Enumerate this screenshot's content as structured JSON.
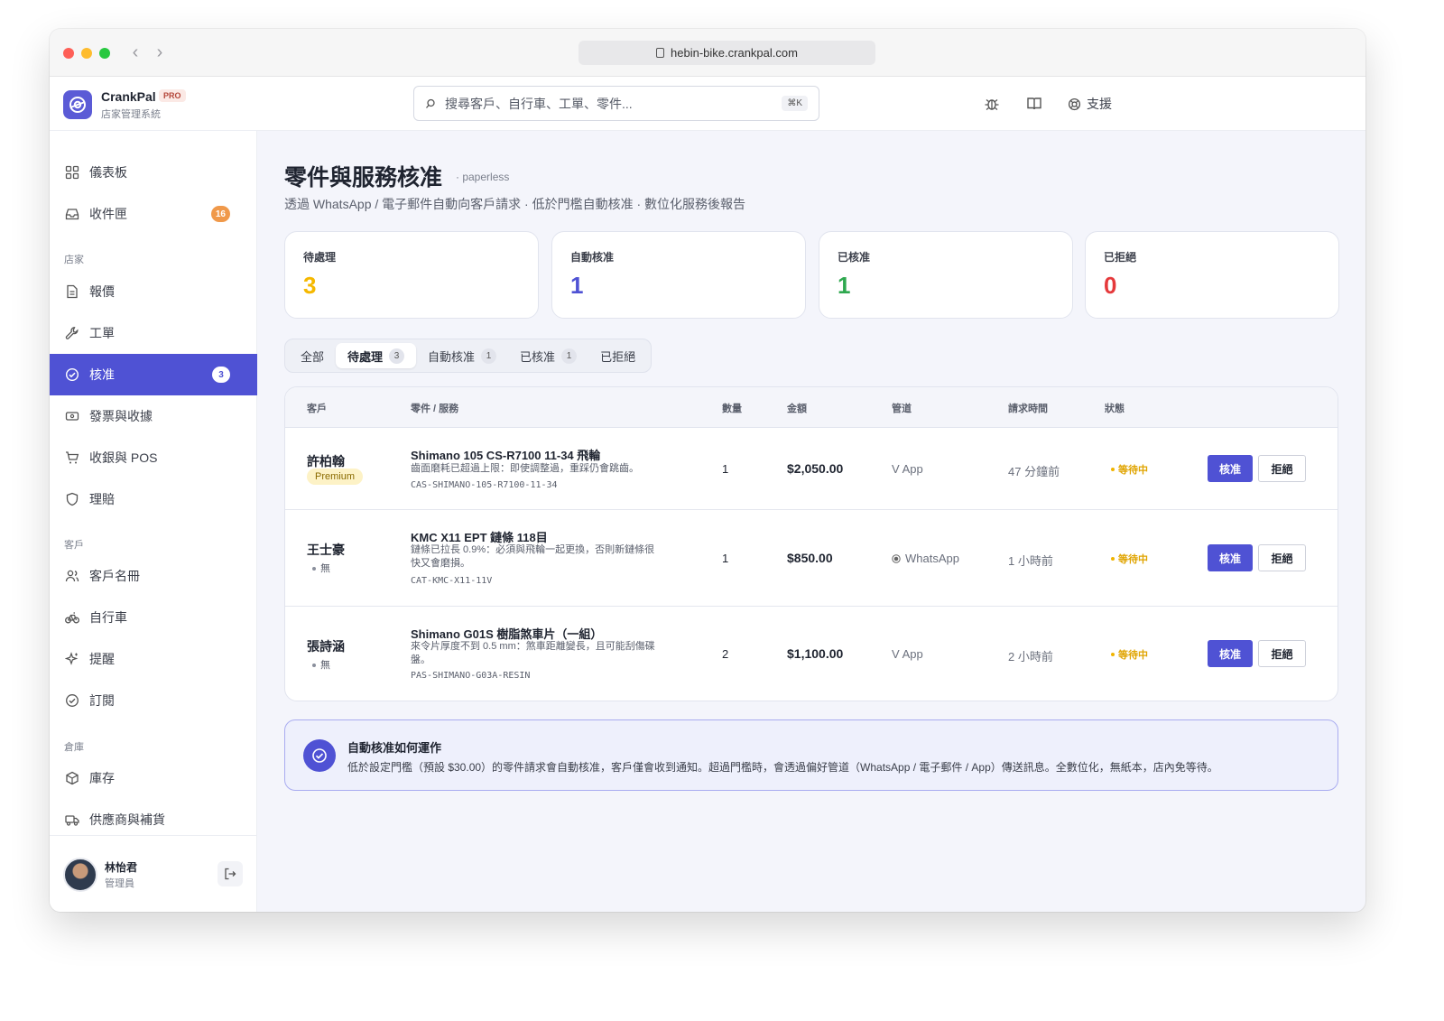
{
  "browser": {
    "url": "hebin-bike.crankpal.com"
  },
  "brand": {
    "name": "CrankPal",
    "badge": "PRO",
    "subtitle": "店家管理系統"
  },
  "search": {
    "placeholder": "搜尋客戶、自行車、工單、零件...",
    "shortcut": "⌘K"
  },
  "topbar": {
    "support_label": "支援"
  },
  "sidebar": {
    "items": [
      {
        "label": "儀表板"
      },
      {
        "label": "收件匣",
        "badge": "16"
      },
      {
        "label": "報價"
      },
      {
        "label": "工單"
      },
      {
        "label": "核准",
        "badge": "3"
      },
      {
        "label": "發票與收據"
      },
      {
        "label": "收銀與 POS"
      },
      {
        "label": "理賠"
      },
      {
        "label": "客戶名冊"
      },
      {
        "label": "自行車"
      },
      {
        "label": "提醒"
      },
      {
        "label": "訂閱"
      },
      {
        "label": "庫存"
      },
      {
        "label": "供應商與補貨"
      }
    ],
    "sections": [
      "店家",
      "客戶",
      "倉庫"
    ],
    "user": {
      "name": "林怡君",
      "role": "管理員"
    }
  },
  "page": {
    "title": "零件與服務核准",
    "tag": "· paperless",
    "subtitle": "透過 WhatsApp / 電子郵件自動向客戶請求 · 低於門檻自動核准 · 數位化服務後報告"
  },
  "stats": [
    {
      "label": "待處理",
      "value": "3",
      "color": "#f5b800"
    },
    {
      "label": "自動核准",
      "value": "1",
      "color": "#4f52d4"
    },
    {
      "label": "已核准",
      "value": "1",
      "color": "#2fa84f"
    },
    {
      "label": "已拒絕",
      "value": "0",
      "color": "#e5393b"
    }
  ],
  "filters": [
    {
      "label": "全部"
    },
    {
      "label": "待處理",
      "count": "3"
    },
    {
      "label": "自動核准",
      "count": "1"
    },
    {
      "label": "已核准",
      "count": "1"
    },
    {
      "label": "已拒絕"
    }
  ],
  "table": {
    "headers": [
      "客戶",
      "零件 / 服務",
      "數量",
      "金額",
      "管道",
      "請求時間",
      "狀態"
    ],
    "approve_label": "核准",
    "reject_label": "拒絕",
    "rows": [
      {
        "customer": "許柏翰",
        "tier": "Premium",
        "part": "Shimano 105 CS-R7100 11-34 飛輪",
        "note": "齒面磨耗已超過上限：即使調整過，重踩仍會跳齒。",
        "sku": "CAS-SHIMANO-105-R7100-11-34",
        "qty": "1",
        "amount": "$2,050.00",
        "channel": "V App",
        "time": "47 分鐘前",
        "status": "等待中"
      },
      {
        "customer": "王士豪",
        "tier": "無",
        "part": "KMC X11 EPT 鏈條 118目",
        "note": "鏈條已拉長 0.9%：必須與飛輪一起更換，否則新鏈條很快又會磨損。",
        "sku": "CAT-KMC-X11-11V",
        "qty": "1",
        "amount": "$850.00",
        "channel": "WhatsApp",
        "time": "1 小時前",
        "status": "等待中"
      },
      {
        "customer": "張詩涵",
        "tier": "無",
        "part": "Shimano G01S 樹脂煞車片（一組）",
        "note": "來令片厚度不到 0.5 mm：煞車距離變長，且可能刮傷碟盤。",
        "sku": "PAS-SHIMANO-G03A-RESIN",
        "qty": "2",
        "amount": "$1,100.00",
        "channel": "V App",
        "time": "2 小時前",
        "status": "等待中"
      }
    ]
  },
  "info": {
    "title": "自動核准如何運作",
    "body": "低於設定門檻（預設 $30.00）的零件請求會自動核准，客戶僅會收到通知。超過門檻時，會透過偏好管道（WhatsApp / 電子郵件 / App）傳送訊息。全數位化，無紙本，店內免等待。"
  }
}
